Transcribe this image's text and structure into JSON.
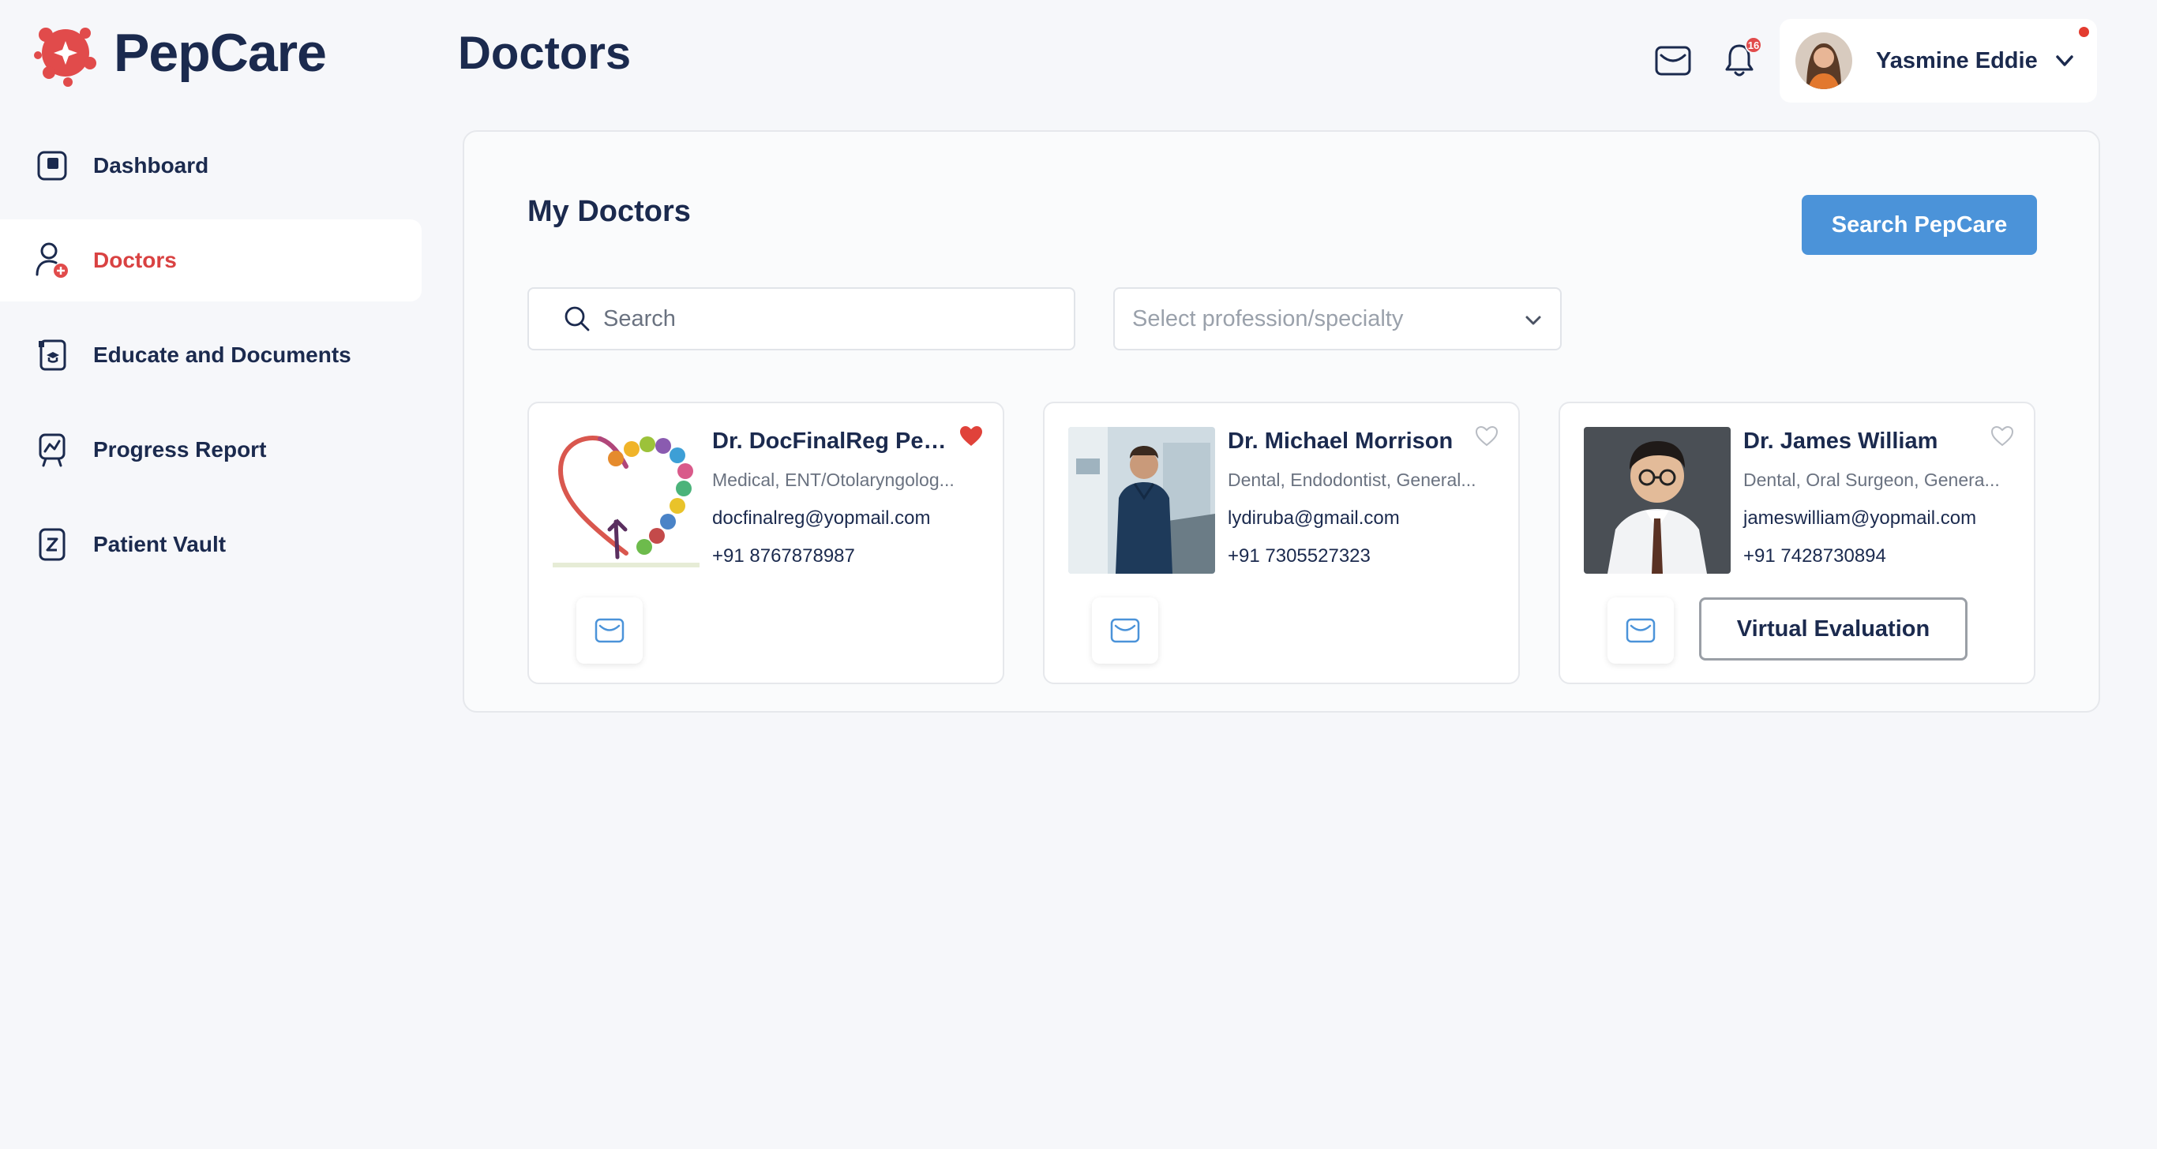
{
  "brand": {
    "name": "PepCare",
    "accent": "#e14b4b",
    "primary": "#4b93d9"
  },
  "page": {
    "title": "Doctors"
  },
  "header": {
    "mail_icon": "mail-icon",
    "bell_icon": "bell-icon",
    "notification_count": "16",
    "user": {
      "name": "Yasmine Eddie"
    }
  },
  "sidebar": {
    "items": [
      {
        "label": "Dashboard",
        "icon": "dashboard-icon",
        "active": false
      },
      {
        "label": "Doctors",
        "icon": "doctor-icon",
        "active": true
      },
      {
        "label": "Educate and Documents",
        "icon": "documents-icon",
        "active": false
      },
      {
        "label": "Progress Report",
        "icon": "progress-report-icon",
        "active": false
      },
      {
        "label": "Patient Vault",
        "icon": "vault-icon",
        "active": false
      }
    ]
  },
  "main": {
    "title": "My Doctors",
    "search_button": "Search PepCare",
    "search": {
      "placeholder": "Search"
    },
    "specialty_select": {
      "placeholder": "Select profession/specialty"
    },
    "doctors": [
      {
        "name": "Dr. DocFinalReg Pep...",
        "specialty": "Medical, ENT/Otolaryngolog...",
        "email": "docfinalreg@yopmail.com",
        "phone": "+91 8767878987",
        "favorite": true
      },
      {
        "name": "Dr. Michael Morrison",
        "specialty": "Dental, Endodontist, General...",
        "email": "lydiruba@gmail.com",
        "phone": "+91 7305527323",
        "favorite": false
      },
      {
        "name": "Dr. James William",
        "specialty": "Dental, Oral Surgeon, Genera...",
        "email": "jameswilliam@yopmail.com",
        "phone": "+91 7428730894",
        "favorite": false,
        "action": "Virtual Evaluation"
      }
    ]
  }
}
